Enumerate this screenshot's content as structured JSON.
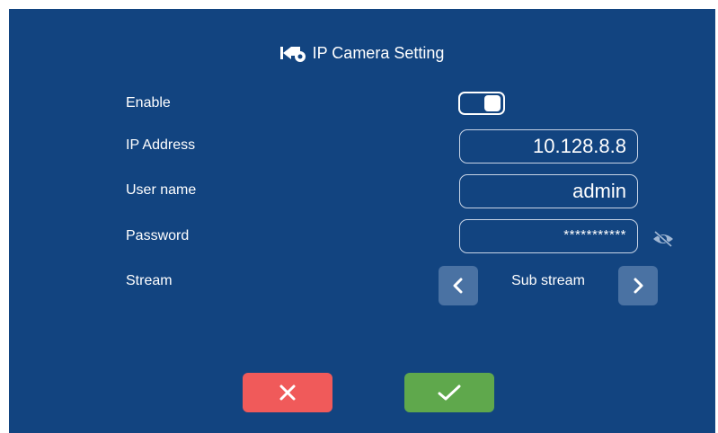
{
  "window": {
    "title": "IP Camera Setting",
    "title_icon": "camera-settings-icon"
  },
  "form": {
    "enable": {
      "label": "Enable",
      "checked": true
    },
    "ip_address": {
      "label": "IP Address",
      "value": "10.128.8.8"
    },
    "user_name": {
      "label": "User name",
      "value": "admin"
    },
    "password": {
      "label": "Password",
      "value": "***********",
      "toggle_icon": "eye-hidden-icon"
    },
    "stream": {
      "label": "Stream",
      "value": "Sub stream",
      "prev_icon": "chevron-left-icon",
      "next_icon": "chevron-right-icon"
    }
  },
  "actions": {
    "cancel_icon": "close-icon",
    "confirm_icon": "check-icon"
  },
  "colors": {
    "background": "#124480",
    "cancel": "#f05a5a",
    "confirm": "#5fa84c",
    "arrow_button": "#4a72a3"
  }
}
